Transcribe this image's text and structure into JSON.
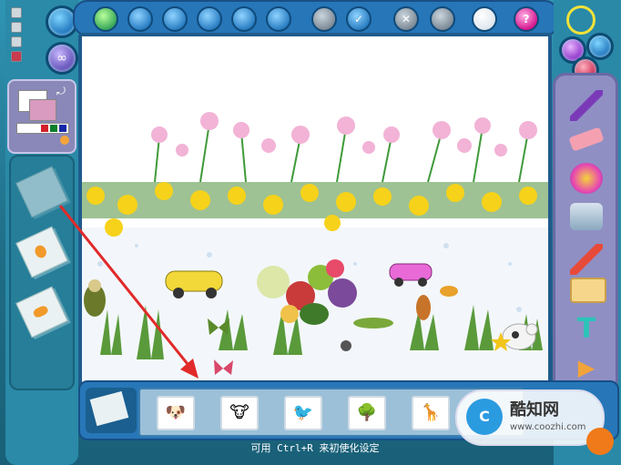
{
  "top_toolbar": {
    "buttons": [
      {
        "icon": "new-icon",
        "variant": "green"
      },
      {
        "icon": "open-icon",
        "variant": "blue"
      },
      {
        "icon": "undo-icon",
        "variant": "blue"
      },
      {
        "icon": "redo-icon",
        "variant": "blue"
      },
      {
        "icon": "save-icon",
        "variant": "blue"
      },
      {
        "icon": "print-icon",
        "variant": "blue"
      },
      {
        "icon": "copy-icon",
        "variant": "grey"
      },
      {
        "icon": "check-icon",
        "variant": "blue"
      },
      {
        "icon": "close-icon",
        "variant": "grey"
      },
      {
        "icon": "window-icon",
        "variant": "grey"
      },
      {
        "icon": "lightbulb-icon",
        "variant": "blue"
      },
      {
        "icon": "help-icon",
        "variant": "help",
        "label": "?"
      }
    ]
  },
  "left": {
    "mini_icons": [
      "file-icon",
      "file-icon",
      "file-icon",
      "bucket-icon"
    ]
  },
  "right": {
    "tools": [
      "brush-icon",
      "eraser-icon",
      "spray-icon",
      "paint-can-icon",
      "dropper-icon",
      "stamp-tool-icon",
      "text-tool-icon",
      "next-arrow-icon"
    ]
  },
  "stamps": [
    "dog-stamp",
    "cow-stamp",
    "bird-stamp",
    "tree-stamp",
    "giraffe-stamp"
  ],
  "status": {
    "text": "可用 Ctrl+R 来初使化设定"
  },
  "watermark": {
    "title": "酷知网",
    "url": "www.coozhi.com"
  },
  "colors": {
    "arrow": "#e12a2a"
  }
}
